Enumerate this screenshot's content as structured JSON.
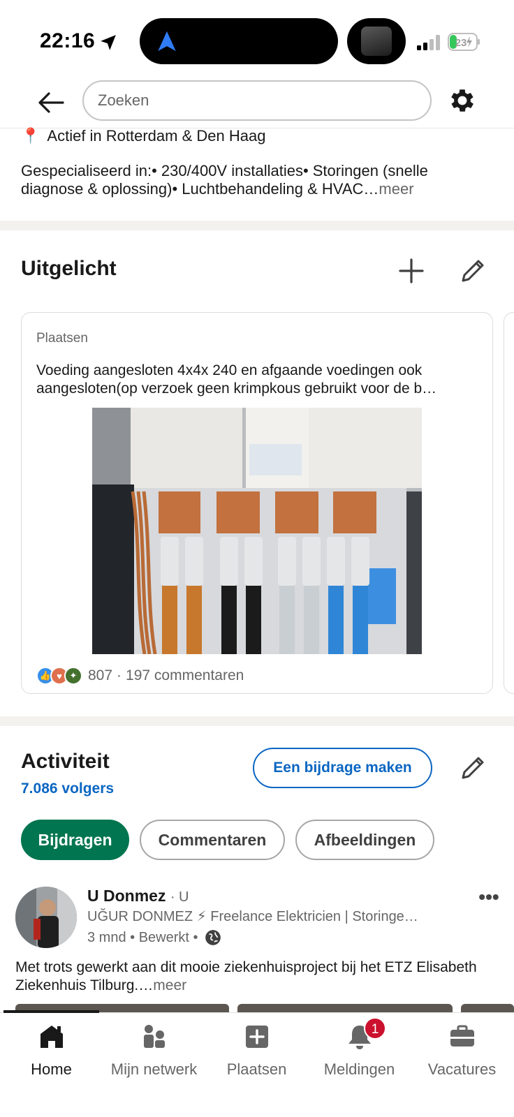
{
  "status_bar": {
    "time": "22:16",
    "battery_level": "23"
  },
  "search": {
    "placeholder": "Zoeken"
  },
  "about": {
    "pin_icon": "📍",
    "location": "Actief in Rotterdam & Den Haag",
    "specialties": "Gespecialiseerd in:• 230/400V installaties• Storingen (snelle diagnose & oplossing)• Luchtbehandeling & HVAC…",
    "more_label": "meer"
  },
  "featured": {
    "title": "Uitgelicht",
    "card": {
      "kind": "Plaatsen",
      "text": "Voeding aangesloten 4x4x 240 en afgaande voedingen ook aangesloten(op verzoek geen krimpkous gebruikt voor de b…",
      "reaction_count": "807",
      "separator": "·",
      "comments": "197 commentaren"
    }
  },
  "activity": {
    "title": "Activiteit",
    "followers": "7.086 volgers",
    "contribute_button": "Een bijdrage maken",
    "tabs": [
      {
        "label": "Bijdragen",
        "active": true
      },
      {
        "label": "Commentaren",
        "active": false
      },
      {
        "label": "Afbeeldingen",
        "active": false
      }
    ]
  },
  "post": {
    "author": "U Donmez",
    "degree": "· U",
    "headline": "UĞUR DONMEZ   ⚡ Freelance Elektricien | Storinge…",
    "meta": "3 mnd • Bewerkt •",
    "body": "Met trots gewerkt aan dit mooie ziekenhuisproject bij het ETZ Elisabeth Ziekenhuis Tilburg.…",
    "more_label": "meer",
    "more_dots": "•••"
  },
  "bottom_nav": {
    "items": [
      {
        "label": "Home",
        "icon": "home-icon",
        "active": true
      },
      {
        "label": "Mijn netwerk",
        "icon": "network-icon",
        "active": false
      },
      {
        "label": "Plaatsen",
        "icon": "post-icon",
        "active": false
      },
      {
        "label": "Meldingen",
        "icon": "bell-icon",
        "active": false,
        "badge": "1"
      },
      {
        "label": "Vacatures",
        "icon": "briefcase-icon",
        "active": false
      }
    ]
  },
  "colors": {
    "brand_blue": "#0a66c2",
    "active_chip_green": "#01754f",
    "badge_red": "#cb112d",
    "battery_green": "#34c759"
  }
}
